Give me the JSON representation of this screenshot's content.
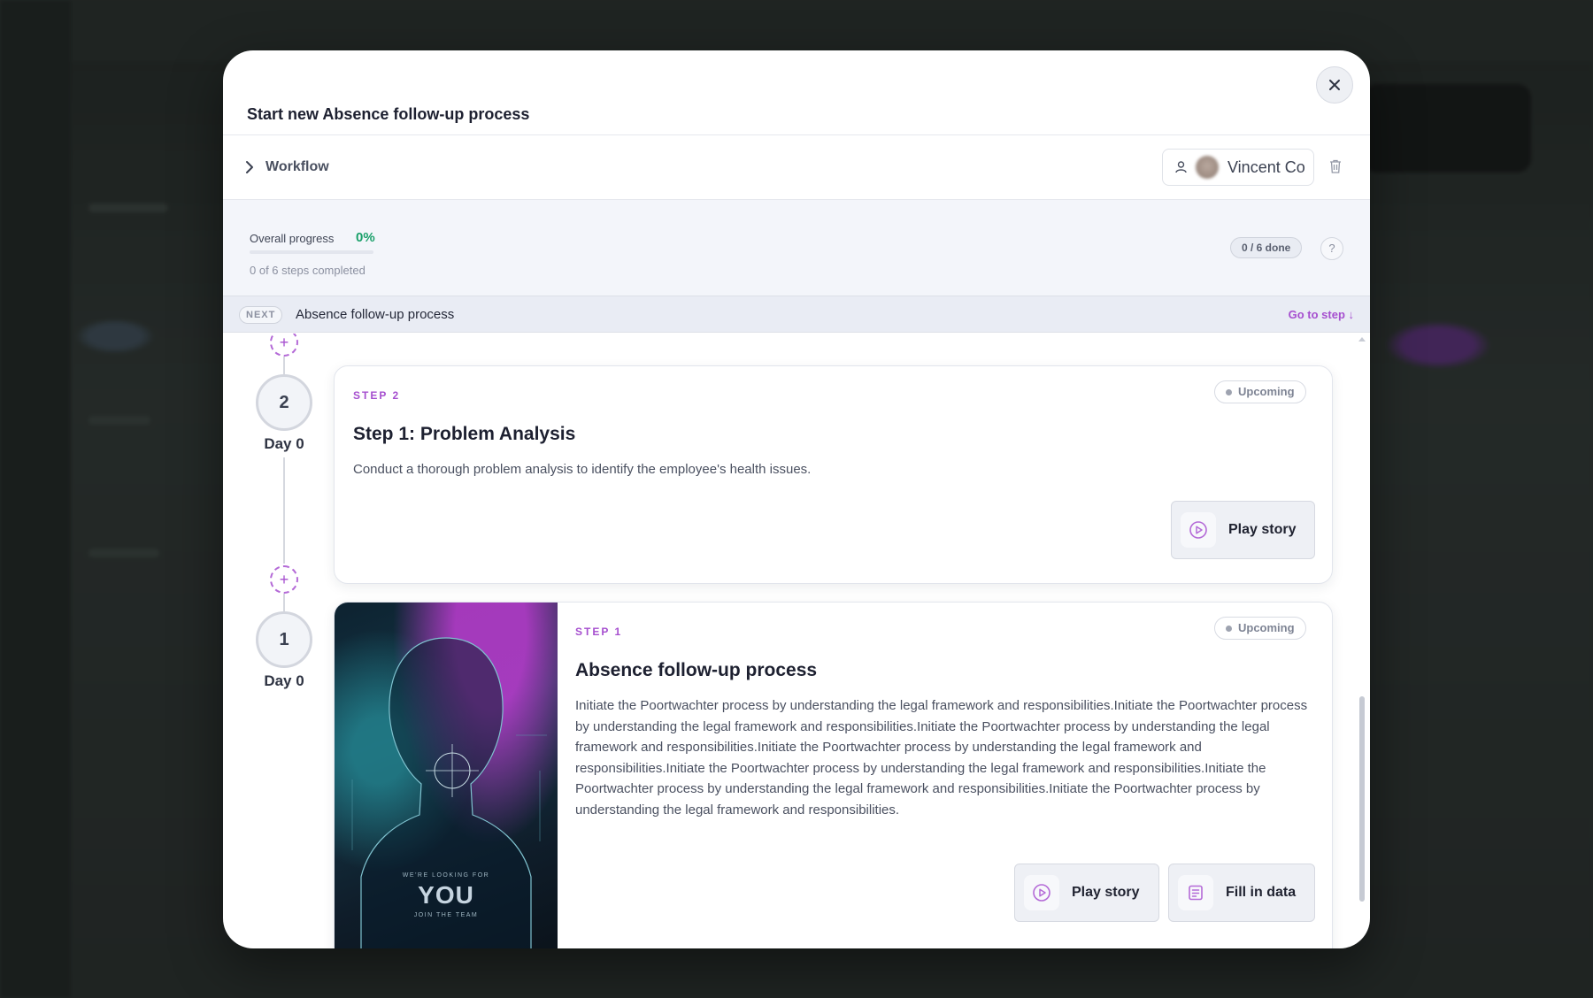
{
  "modal": {
    "title": "Start new Absence follow-up process",
    "workflow_label": "Workflow",
    "assignee_name": "Vincent Co"
  },
  "progress": {
    "label": "Overall progress",
    "percent_text": "0%",
    "percent_value": 0,
    "subtitle": "0 of 6 steps completed",
    "done_pill": "0 / 6 done",
    "help": "?"
  },
  "next_bar": {
    "badge": "NEXT",
    "title": "Absence follow-up process",
    "goto": "Go to step ↓"
  },
  "timeline": [
    {
      "number": "2",
      "day": "Day 0",
      "step_tag": "STEP 2",
      "status": "Upcoming",
      "title": "Step 1: Problem Analysis",
      "description": "Conduct a thorough problem analysis to identify the employee's health issues.",
      "actions": [
        "Play story"
      ]
    },
    {
      "number": "1",
      "day": "Day 0",
      "step_tag": "STEP 1",
      "status": "Upcoming",
      "title": "Absence follow-up process",
      "description": "Initiate the Poortwachter process by understanding the legal framework and responsibilities.Initiate the Poortwachter process by understanding the legal framework and responsibilities.Initiate the Poortwachter process by understanding the legal framework and responsibilities.Initiate the Poortwachter process by understanding the legal framework and responsibilities.Initiate the Poortwachter process by understanding the legal framework and responsibilities.Initiate the Poortwachter process by understanding the legal framework and responsibilities.Initiate the Poortwachter process by understanding the legal framework and responsibilities.",
      "actions": [
        "Play story",
        "Fill in data"
      ],
      "thumbnail": {
        "small_text": "WE'RE LOOKING FOR",
        "big_text": "YOU",
        "bottom_text": "JOIN THE TEAM"
      }
    }
  ],
  "icons": {
    "close": "close-icon",
    "chevron": "chevron-right-icon",
    "user": "user-icon",
    "trash": "trash-icon",
    "play": "play-circle-icon",
    "form": "form-icon",
    "add": "add-step-icon"
  },
  "colors": {
    "accent": "#a64fcf",
    "success": "#1aa06a"
  }
}
